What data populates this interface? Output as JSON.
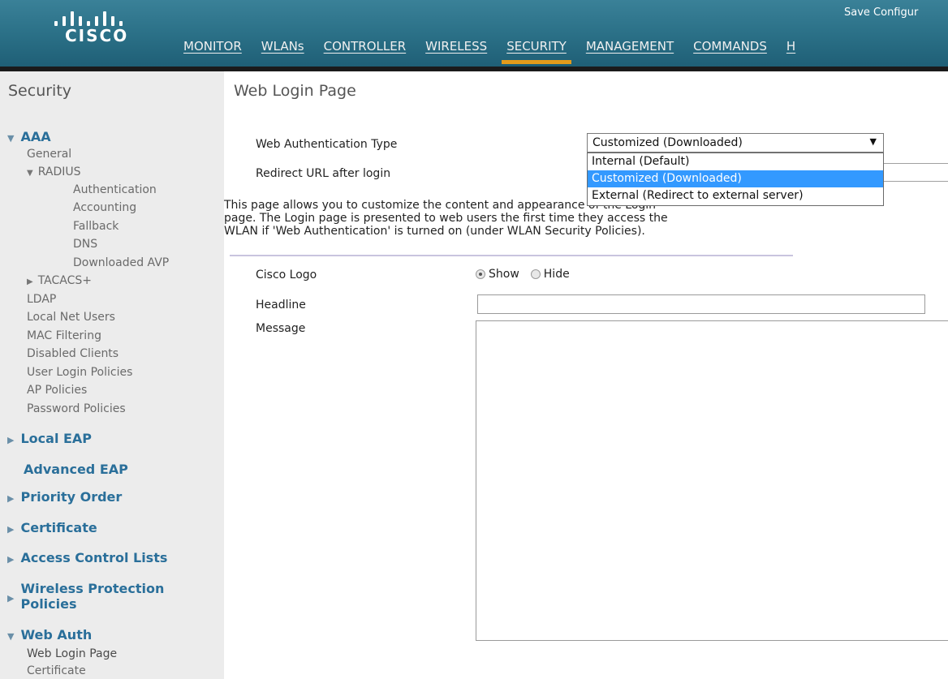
{
  "header": {
    "logo_text": "CISCO",
    "save_config": "Save Configur",
    "menu": [
      {
        "label": "MONITOR"
      },
      {
        "label": "WLANs"
      },
      {
        "label": "CONTROLLER"
      },
      {
        "label": "WIRELESS"
      },
      {
        "label": "SECURITY",
        "active": true
      },
      {
        "label": "MANAGEMENT"
      },
      {
        "label": "COMMANDS"
      },
      {
        "label": "H"
      }
    ]
  },
  "sidebar": {
    "title": "Security",
    "aaa": "AAA",
    "general": "General",
    "radius": "RADIUS",
    "authentication": "Authentication",
    "accounting": "Accounting",
    "fallback": "Fallback",
    "dns": "DNS",
    "downloaded_avp": "Downloaded AVP",
    "tacacs": "TACACS+",
    "ldap": "LDAP",
    "local_net_users": "Local Net Users",
    "mac_filtering": "MAC Filtering",
    "disabled_clients": "Disabled Clients",
    "user_login_policies": "User Login Policies",
    "ap_policies": "AP Policies",
    "password_policies": "Password Policies",
    "local_eap": "Local EAP",
    "advanced_eap": "Advanced EAP",
    "priority_order": "Priority Order",
    "certificate": "Certificate",
    "access_control_lists": "Access Control Lists",
    "wireless_protection_1": "Wireless Protection",
    "wireless_protection_2": "Policies",
    "web_auth": "Web Auth",
    "web_login_page": "Web Login Page",
    "web_certificate": "Certificate"
  },
  "main": {
    "title": "Web Login Page",
    "auth_type_label": "Web Authentication Type",
    "auth_type_value": "Customized (Downloaded)",
    "auth_type_options": [
      "Internal (Default)",
      "Customized (Downloaded)",
      "External (Redirect to external server)"
    ],
    "redirect_label": "Redirect URL after login",
    "description_line1": "This page allows you to customize the content and appearance of the Login",
    "description_line2": "page. The Login page is presented to web users the first time they access the",
    "description_line3": "WLAN if 'Web Authentication' is turned on (under WLAN Security Policies).",
    "cisco_logo_label": "Cisco Logo",
    "show_label": "Show",
    "hide_label": "Hide",
    "headline_label": "Headline",
    "message_label": "Message"
  }
}
